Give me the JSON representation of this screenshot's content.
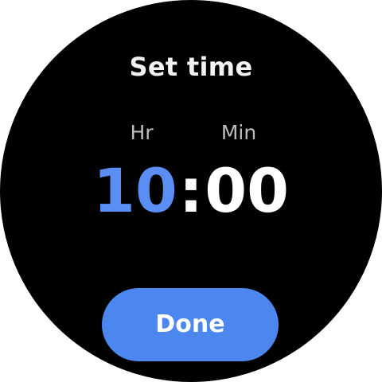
{
  "screen": {
    "title": "Set time"
  },
  "picker": {
    "hour_label": "Hr",
    "minute_label": "Min",
    "hours": "10",
    "separator": ":",
    "minutes": "00",
    "selected_field": "hours"
  },
  "actions": {
    "done_label": "Done"
  },
  "colors": {
    "background": "#000000",
    "accent": "#5b8ef5",
    "button": "#4c87f0",
    "text": "#ffffff"
  }
}
